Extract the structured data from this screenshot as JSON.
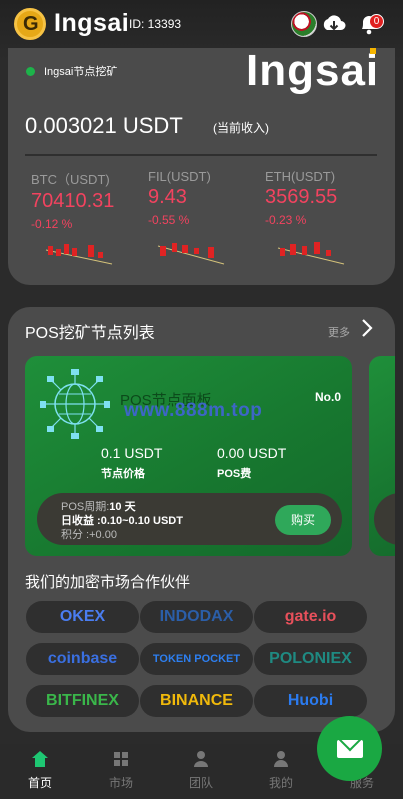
{
  "header": {
    "brand": "Ingsai",
    "user_id": "ID: 13393",
    "notification_count": "0"
  },
  "hero": {
    "node_label": "Ingsai节点挖矿",
    "brand_big": "Ingsai",
    "amount": "0.003021 USDT",
    "amount_note": "(当前收入)",
    "coins": [
      {
        "name": "BTC（USDT)",
        "price": "70410.31",
        "change": "-0.12 %"
      },
      {
        "name": "FIL(USDT)",
        "price": "9.43",
        "change": "-0.55 %"
      },
      {
        "name": "ETH(USDT)",
        "price": "3569.55",
        "change": "-0.23 %"
      }
    ]
  },
  "pos": {
    "title": "POS挖矿节点列表",
    "more": "更多",
    "card": {
      "panel_title": "POS节点面板",
      "watermark": "www.888m.top",
      "level": "No.0",
      "price_value": "0.1 USDT",
      "price_label": "节点价格",
      "fee_value": "0.00 USDT",
      "fee_label": "POS费",
      "period_label": "POS周期:",
      "period_value": "10 天",
      "daily_label": "日收益 :0.10~0.10 USDT",
      "points": "积分 :+0.00",
      "buy": "购买"
    },
    "partners_title": "我们的加密市场合作伙伴",
    "partners": [
      {
        "name": "OKEX",
        "color": "#4a7df0"
      },
      {
        "name": "INDODAX",
        "color": "#2b5ea8"
      },
      {
        "name": "gate.io",
        "color": "#e8505b"
      },
      {
        "name": "coinbase",
        "color": "#3a6fe0"
      },
      {
        "name": "TOKEN POCKET",
        "color": "#2d7ff0"
      },
      {
        "name": "POLONIEX",
        "color": "#1f6e6a"
      },
      {
        "name": "BITFINEX",
        "color": "#3ab64a"
      },
      {
        "name": "BINANCE",
        "color": "#f0b90b"
      },
      {
        "name": "Huobi",
        "color": "#2b7bef"
      }
    ]
  },
  "tabs": [
    {
      "label": "首页",
      "icon": "home-icon"
    },
    {
      "label": "市场",
      "icon": "market-icon"
    },
    {
      "label": "团队",
      "icon": "team-icon"
    },
    {
      "label": "我的",
      "icon": "user-icon"
    },
    {
      "label": "服务",
      "icon": "service-icon"
    }
  ]
}
